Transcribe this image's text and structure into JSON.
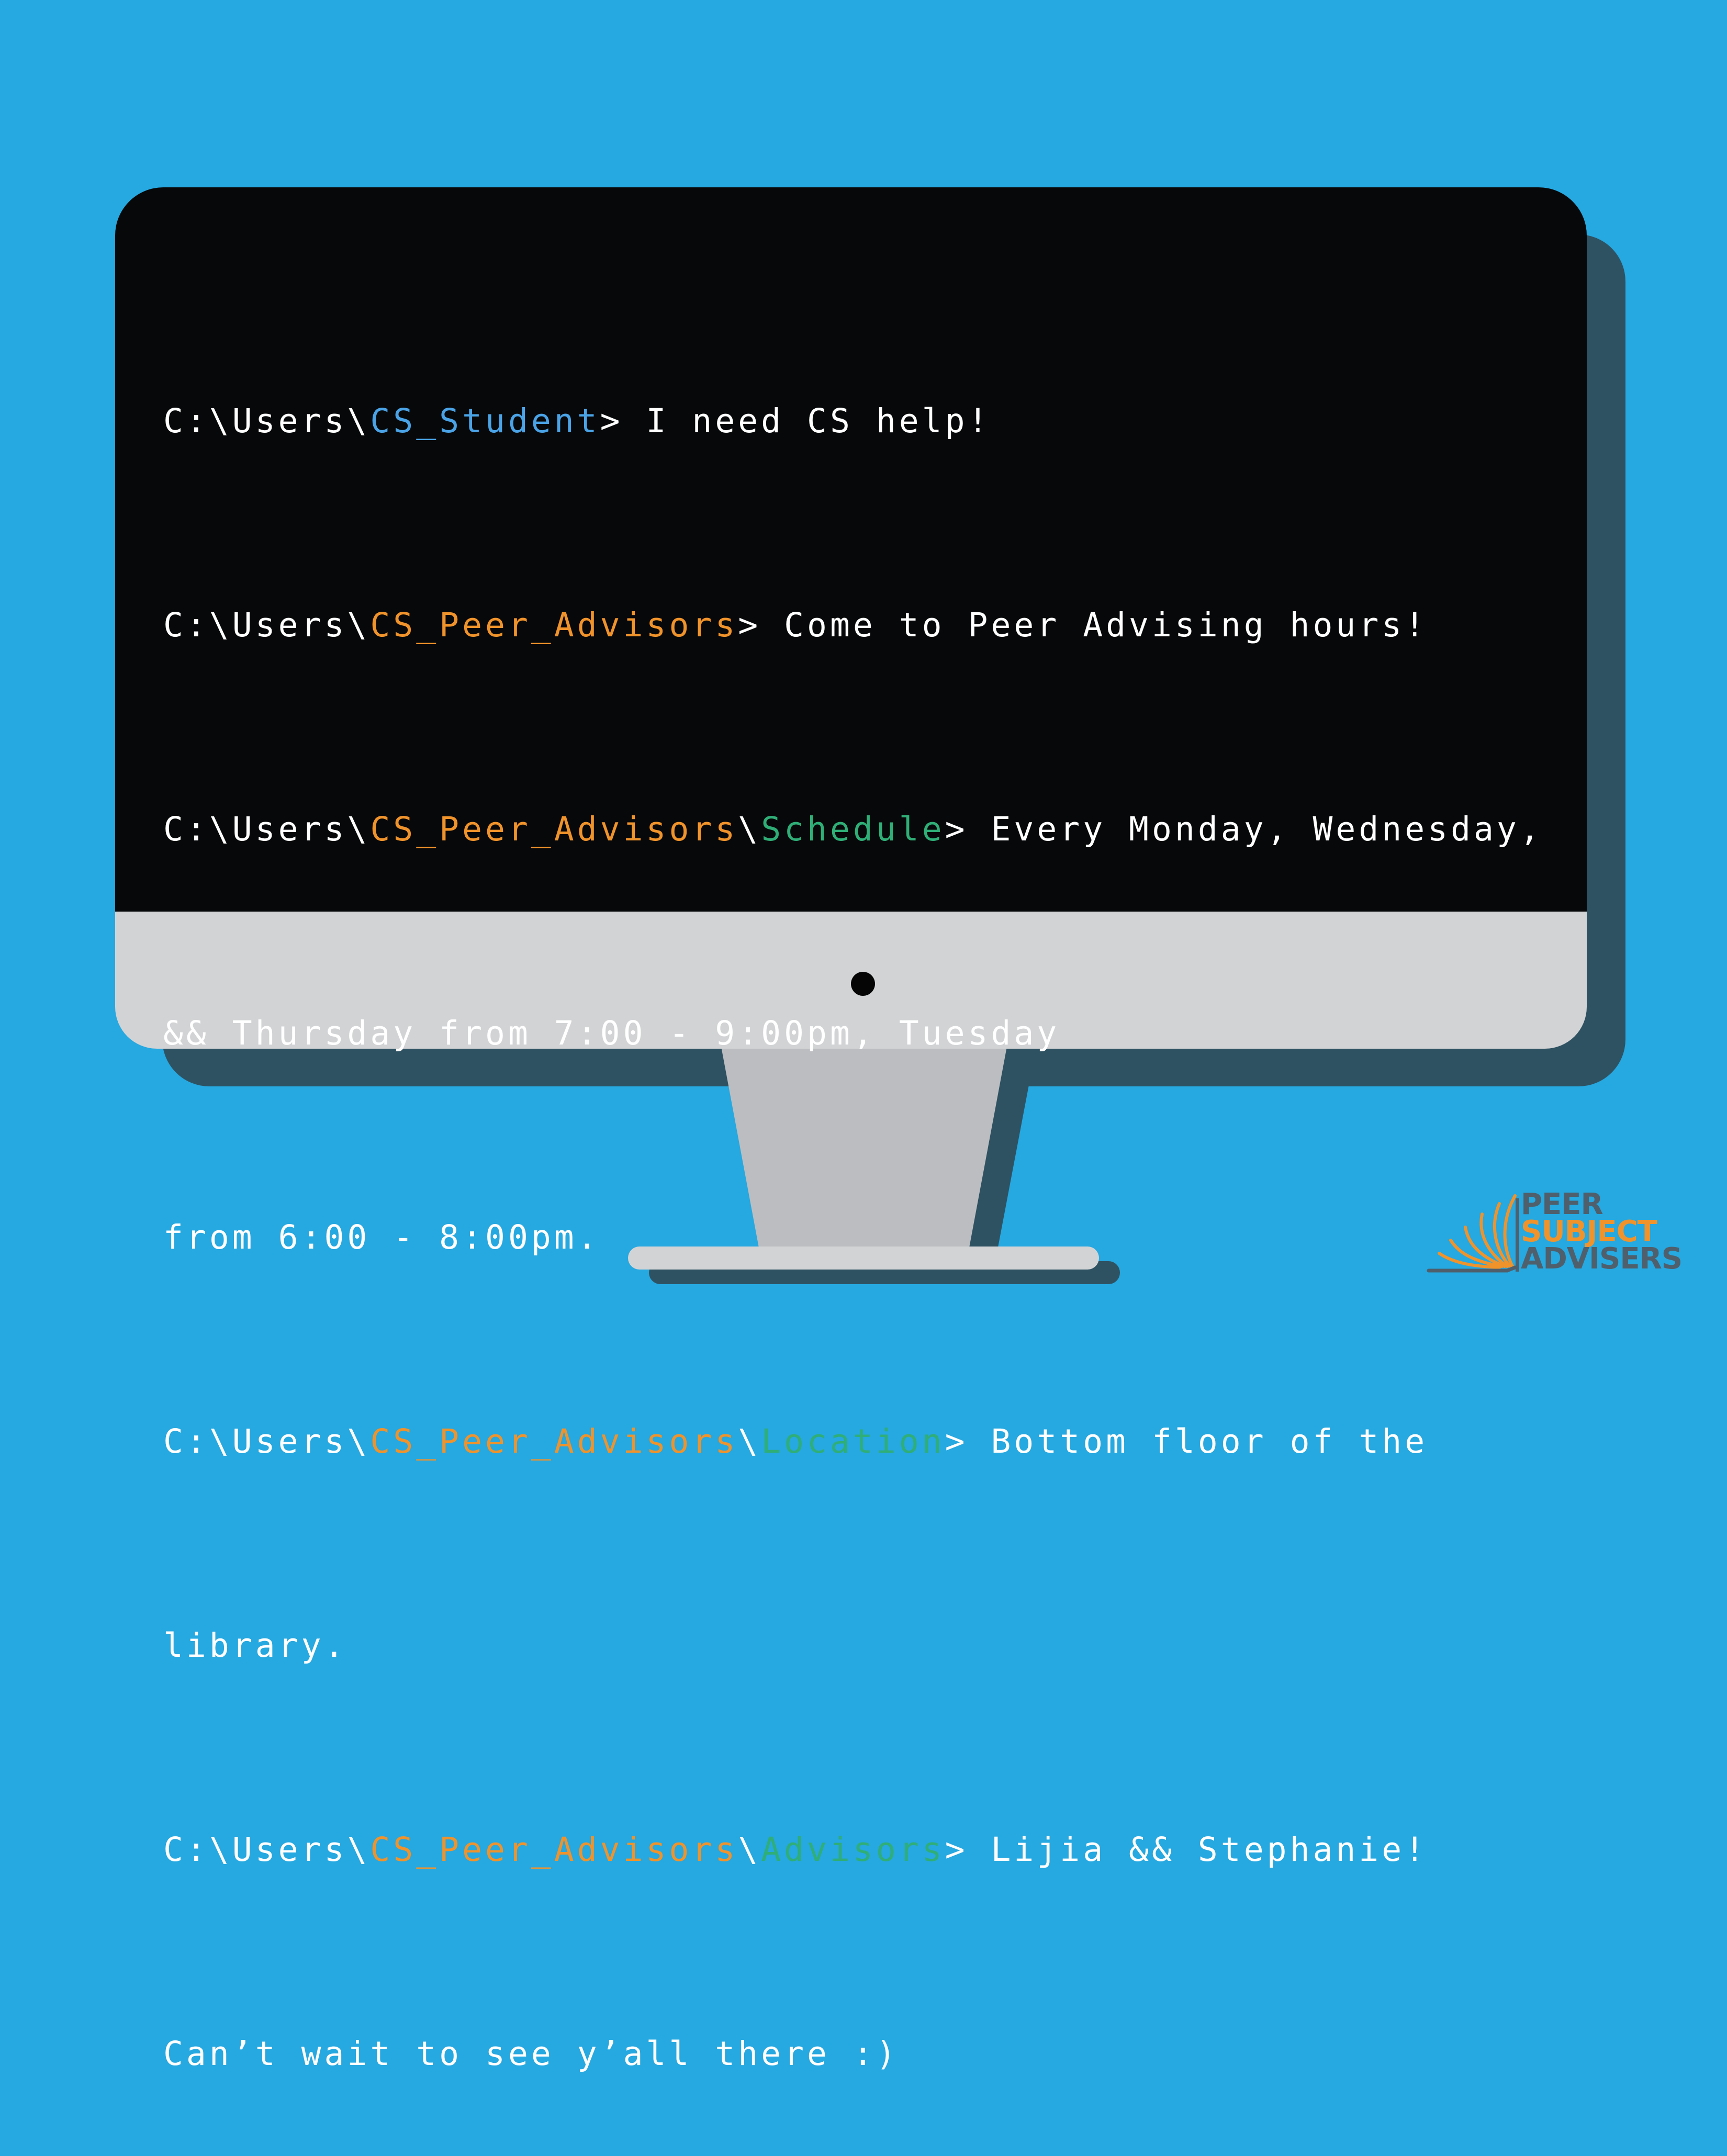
{
  "terminal": {
    "lines": [
      {
        "segments": [
          "C:\\Users\\",
          "CS_Student",
          "> I need CS help!"
        ]
      },
      {
        "segments": [
          "C:\\Users\\",
          "CS_Peer_Advisors",
          "> Come to Peer Advising hours!"
        ]
      },
      {
        "segments": [
          "C:\\Users\\",
          "CS_Peer_Advisors",
          "\\",
          "Schedule",
          "> Every Monday, Wednesday,"
        ]
      },
      {
        "segments": [
          "&& Thursday from 7:00 - 9:00pm, Tuesday"
        ]
      },
      {
        "segments": [
          "from 6:00 - 8:00pm."
        ]
      },
      {
        "segments": [
          "C:\\Users\\",
          "CS_Peer_Advisors",
          "\\",
          "Location",
          "> Bottom floor of the"
        ]
      },
      {
        "segments": [
          "library."
        ]
      },
      {
        "segments": [
          "C:\\Users\\",
          "CS_Peer_Advisors",
          "\\",
          "Advisors",
          "> Lijia && Stephanie!"
        ]
      },
      {
        "segments": [
          "Can’t wait to see y’all there :)"
        ]
      }
    ]
  },
  "logo": {
    "line1": "PEER",
    "line2": "SUBJECT",
    "line3": "ADVISERS",
    "icon": "open-book-icon"
  },
  "colors": {
    "background": "#26a8e0",
    "screen": "#070809",
    "bezel": "#d2d3d5",
    "shadow": "#2f5262",
    "path_blue": "#4aa3e6",
    "path_orange": "#f0932b",
    "path_green": "#2fae77",
    "logo_gray": "#4f5f6b"
  }
}
